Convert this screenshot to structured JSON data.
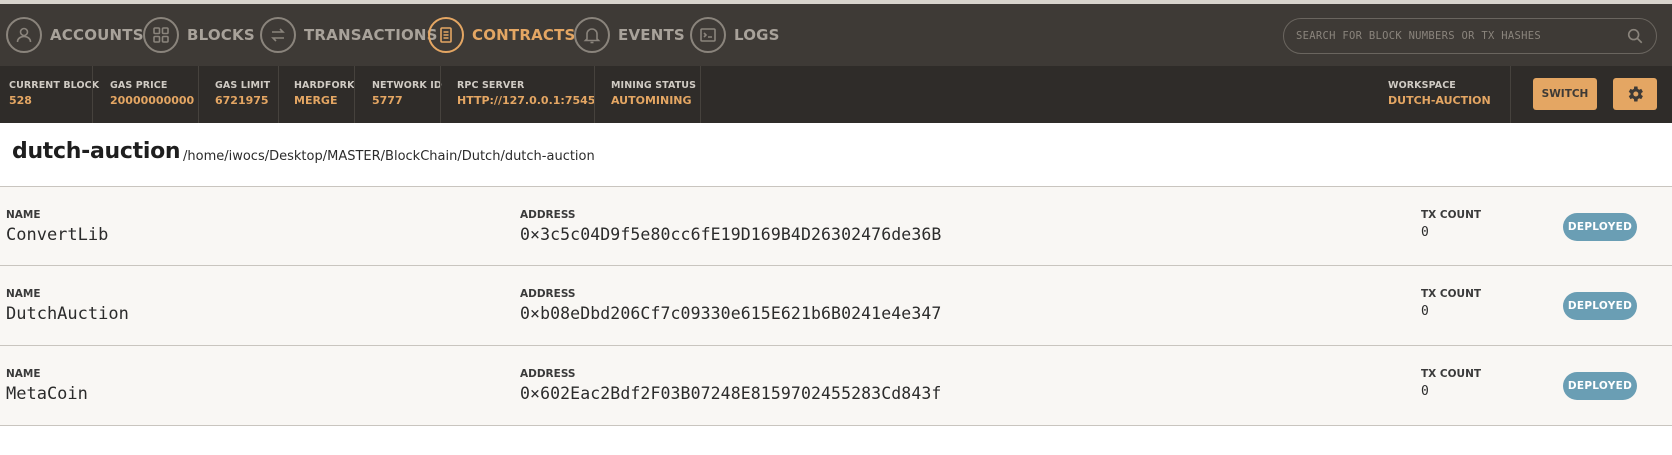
{
  "nav": {
    "items": [
      {
        "label": "ACCOUNTS",
        "icon": "user-icon",
        "active": false
      },
      {
        "label": "BLOCKS",
        "icon": "grid-icon",
        "active": false
      },
      {
        "label": "TRANSACTIONS",
        "icon": "swap-arrows-icon",
        "active": false
      },
      {
        "label": "CONTRACTS",
        "icon": "document-icon",
        "active": true
      },
      {
        "label": "EVENTS",
        "icon": "bell-icon",
        "active": false
      },
      {
        "label": "LOGS",
        "icon": "terminal-icon",
        "active": false
      }
    ],
    "search_placeholder": "SEARCH FOR BLOCK NUMBERS OR TX HASHES"
  },
  "status": {
    "current_block": {
      "label": "CURRENT BLOCK",
      "value": "528"
    },
    "gas_price": {
      "label": "GAS PRICE",
      "value": "20000000000"
    },
    "gas_limit": {
      "label": "GAS LIMIT",
      "value": "6721975"
    },
    "hardfork": {
      "label": "HARDFORK",
      "value": "MERGE"
    },
    "network_id": {
      "label": "NETWORK ID",
      "value": "5777"
    },
    "rpc_server": {
      "label": "RPC SERVER",
      "value": "HTTP://127.0.0.1:7545"
    },
    "mining_status": {
      "label": "MINING STATUS",
      "value": "AUTOMINING"
    },
    "workspace": {
      "label": "WORKSPACE",
      "value": "DUTCH-AUCTION"
    },
    "switch_label": "SWITCH"
  },
  "page": {
    "title": "dutch-auction",
    "path": "/home/iwocs/Desktop/MASTER/BlockChain/Dutch/dutch-auction"
  },
  "columns": {
    "name": "NAME",
    "address": "ADDRESS",
    "tx_count": "TX COUNT"
  },
  "contracts": [
    {
      "name": "ConvertLib",
      "address": "0×3c5c04D9f5e80cc6fE19D169B4D26302476de36B",
      "tx_count": "0",
      "status": "DEPLOYED"
    },
    {
      "name": "DutchAuction",
      "address": "0×b08eDbd206Cf7c09330e615E621b6B0241e4e347",
      "tx_count": "0",
      "status": "DEPLOYED"
    },
    {
      "name": "MetaCoin",
      "address": "0×602Eac2Bdf2F03B07248E8159702455283Cd843f",
      "tx_count": "0",
      "status": "DEPLOYED"
    }
  ],
  "colors": {
    "accent": "#e4a663",
    "nav_bg": "#3e3a36",
    "status_bg": "#2f2c29",
    "badge": "#6a9eb4"
  }
}
